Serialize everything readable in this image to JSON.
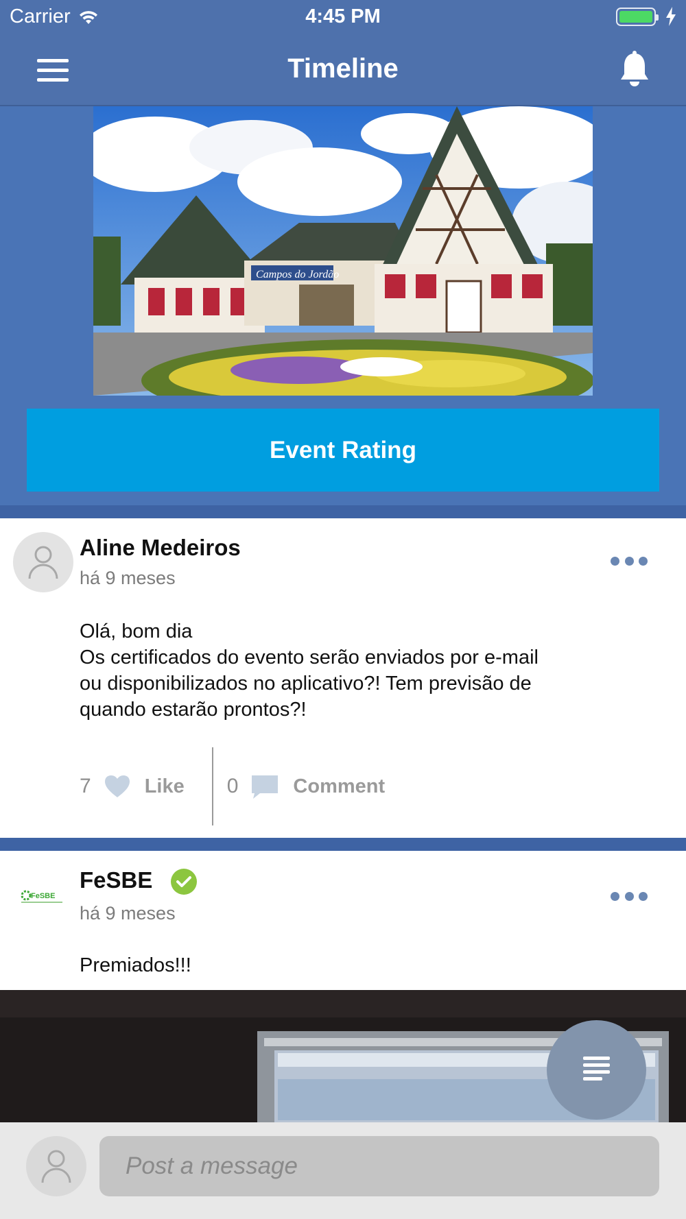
{
  "status_bar": {
    "carrier": "Carrier",
    "time": "4:45 PM",
    "battery_color": "#4cd964"
  },
  "nav": {
    "title": "Timeline",
    "left_icon": "menu-icon",
    "right_icon": "bell-icon"
  },
  "banner": {
    "sign_text": "Campos do Jordão",
    "button_label": "Event Rating",
    "button_color": "#009ee0"
  },
  "posts": [
    {
      "author": "Aline Medeiros",
      "time": "há 9 meses",
      "body_lines": [
        "Olá, bom dia",
        "Os certificados do evento serão enviados por e-mail",
        "ou disponibilizados no aplicativo?! Tem previsão de",
        "quando estarão prontos?!"
      ],
      "likes": "7",
      "like_label": "Like",
      "comments": "0",
      "comment_label": "Comment"
    },
    {
      "author": "FeSBE",
      "verified": true,
      "time": "há 9 meses",
      "body": "Premiados!!!",
      "logo_text": "FeSBE"
    }
  ],
  "composer": {
    "placeholder": "Post a message"
  },
  "colors": {
    "header": "#4e71ac",
    "banner_bg": "#4a74b6",
    "separator": "#3e63a4",
    "fab": "#8294ac",
    "verified": "#8cc63f"
  }
}
